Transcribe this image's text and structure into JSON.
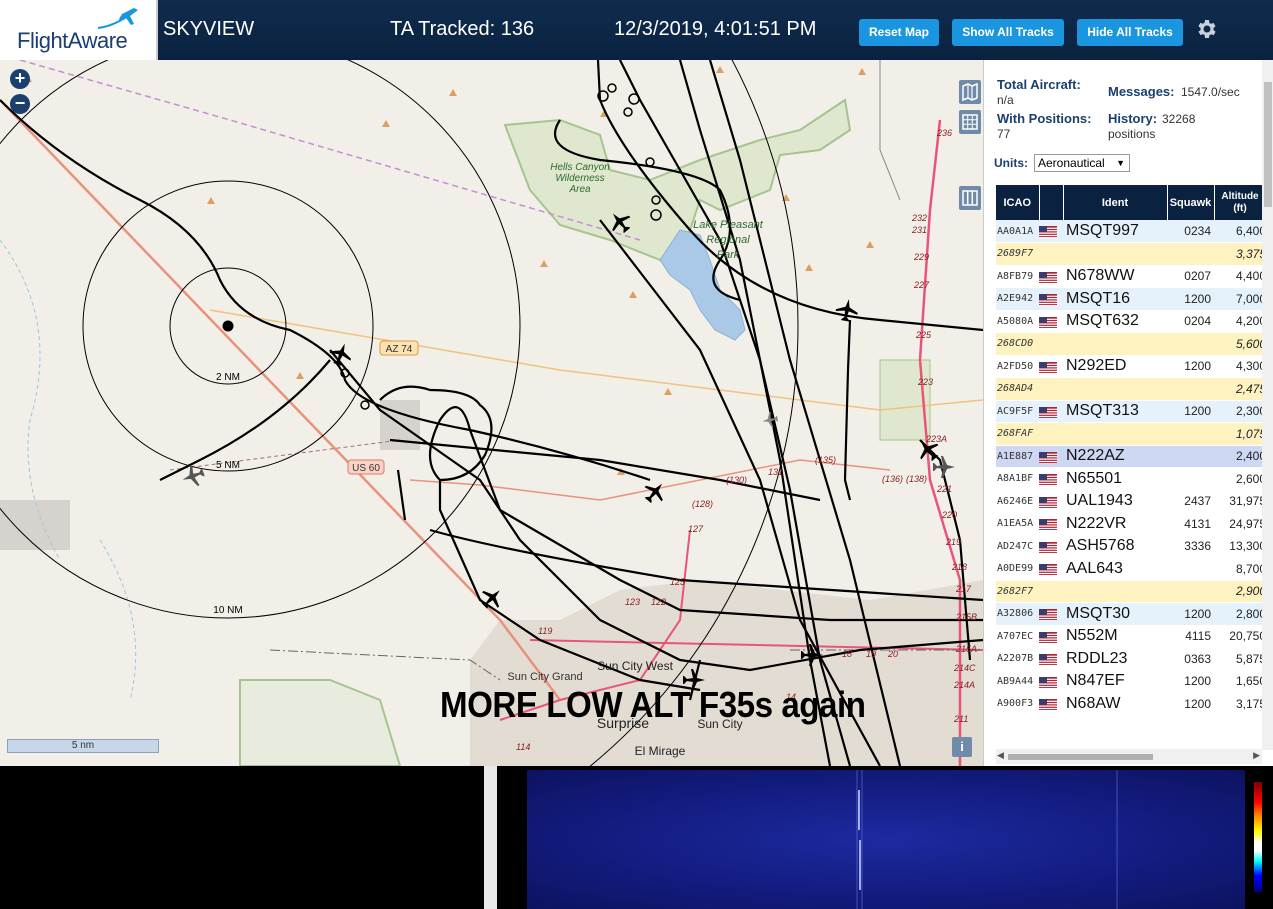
{
  "header": {
    "logo_text": "FlightAware",
    "app_name": "SKYVIEW",
    "tracked": "TA Tracked: 136",
    "datetime": "12/3/2019, 4:01:51 PM",
    "reset_btn": "Reset Map",
    "show_btn": "Show All Tracks",
    "hide_btn": "Hide All Tracks",
    "settings_icon": "gear-icon"
  },
  "map": {
    "zoom_in": "+",
    "zoom_out": "−",
    "scale_label": "5 nm",
    "caption": "MORE LOW ALT F35s again",
    "info_icon": "i",
    "range_labels": [
      "2 NM",
      "5 NM",
      "10 NM"
    ],
    "place_labels": [
      "Hells Canyon Wilderness Area",
      "Lake Pleasant Regional Park",
      "Sun City West",
      "Sun City Grand",
      "Surprise",
      "Sun City",
      "El Mirage"
    ],
    "road_labels": [
      "AZ 74",
      "US 60"
    ],
    "route_numbers": [
      "236",
      "232",
      "231",
      "229",
      "227",
      "225",
      "223",
      "221",
      "220",
      "219",
      "218",
      "217",
      "215B",
      "215A",
      "214C",
      "214A",
      "211",
      "(128)",
      "127",
      "125",
      "123",
      "122",
      "119",
      "(130)",
      "131",
      "(135)",
      "(136)",
      "(138)",
      "18",
      "19",
      "20",
      "14",
      "114",
      "223A"
    ]
  },
  "sidebar": {
    "total_label": "Total Aircraft:",
    "total_value": "n/a",
    "messages_label": "Messages:",
    "messages_value": "1547.0/sec",
    "positions_label": "With Positions:",
    "positions_value": "77",
    "history_label": "History:",
    "history_value": "32268",
    "history_unit": "positions",
    "units_label": "Units:",
    "units_value": "Aeronautical",
    "columns": [
      "ICAO",
      "",
      "Ident",
      "Squawk",
      "Altitude (ft)"
    ],
    "rows": [
      {
        "icao": "AA0A1A",
        "flag": true,
        "ident": "MSQT997",
        "squawk": "0234",
        "alt": "6,400",
        "style": "blue"
      },
      {
        "icao": "2689F7",
        "flag": false,
        "ident": "",
        "squawk": "",
        "alt": "3,375",
        "style": "yellow"
      },
      {
        "icao": "A8FB79",
        "flag": true,
        "ident": "N678WW",
        "squawk": "0207",
        "alt": "4,400",
        "style": "white"
      },
      {
        "icao": "A2E942",
        "flag": true,
        "ident": "MSQT16",
        "squawk": "1200",
        "alt": "7,000",
        "style": "blue"
      },
      {
        "icao": "A5080A",
        "flag": true,
        "ident": "MSQT632",
        "squawk": "0204",
        "alt": "4,200",
        "style": "white"
      },
      {
        "icao": "268CD0",
        "flag": false,
        "ident": "",
        "squawk": "",
        "alt": "5,600",
        "style": "yellow"
      },
      {
        "icao": "A2FD50",
        "flag": true,
        "ident": "N292ED",
        "squawk": "1200",
        "alt": "4,300",
        "style": "white"
      },
      {
        "icao": "268AD4",
        "flag": false,
        "ident": "",
        "squawk": "",
        "alt": "2,475",
        "style": "yellow"
      },
      {
        "icao": "AC9F5F",
        "flag": true,
        "ident": "MSQT313",
        "squawk": "1200",
        "alt": "2,300",
        "style": "blue"
      },
      {
        "icao": "268FAF",
        "flag": false,
        "ident": "",
        "squawk": "",
        "alt": "1,075",
        "style": "yellow"
      },
      {
        "icao": "A1E887",
        "flag": true,
        "ident": "N222AZ",
        "squawk": "",
        "alt": "2,400",
        "style": "sel"
      },
      {
        "icao": "A8A1BF",
        "flag": true,
        "ident": "N65501",
        "squawk": "",
        "alt": "2,600",
        "style": "white"
      },
      {
        "icao": "A6246E",
        "flag": true,
        "ident": "UAL1943",
        "squawk": "2437",
        "alt": "31,975",
        "style": "white"
      },
      {
        "icao": "A1EA5A",
        "flag": true,
        "ident": "N222VR",
        "squawk": "4131",
        "alt": "24,975",
        "style": "white"
      },
      {
        "icao": "AD247C",
        "flag": true,
        "ident": "ASH5768",
        "squawk": "3336",
        "alt": "13,300",
        "style": "white"
      },
      {
        "icao": "A0DE99",
        "flag": true,
        "ident": "AAL643",
        "squawk": "",
        "alt": "8,700",
        "style": "white"
      },
      {
        "icao": "2682F7",
        "flag": false,
        "ident": "",
        "squawk": "",
        "alt": "2,900",
        "style": "yellow"
      },
      {
        "icao": "A32806",
        "flag": true,
        "ident": "MSQT30",
        "squawk": "1200",
        "alt": "2,800",
        "style": "blue"
      },
      {
        "icao": "A707EC",
        "flag": true,
        "ident": "N552M",
        "squawk": "4115",
        "alt": "20,750",
        "style": "white"
      },
      {
        "icao": "A2207B",
        "flag": true,
        "ident": "RDDL23",
        "squawk": "0363",
        "alt": "5,875",
        "style": "white"
      },
      {
        "icao": "AB9A44",
        "flag": true,
        "ident": "N847EF",
        "squawk": "1200",
        "alt": "1,650",
        "style": "white"
      },
      {
        "icao": "A900F3",
        "flag": true,
        "ident": "N68AW",
        "squawk": "1200",
        "alt": "3,175",
        "style": "white"
      }
    ]
  },
  "colors": {
    "header_bg": "#0a2240",
    "button_bg": "#1a96e0",
    "row_blue": "#e5f2fb",
    "row_yellow": "#fef3c0",
    "row_selected": "#cfd8f2",
    "map_bg": "#f2efe9"
  }
}
